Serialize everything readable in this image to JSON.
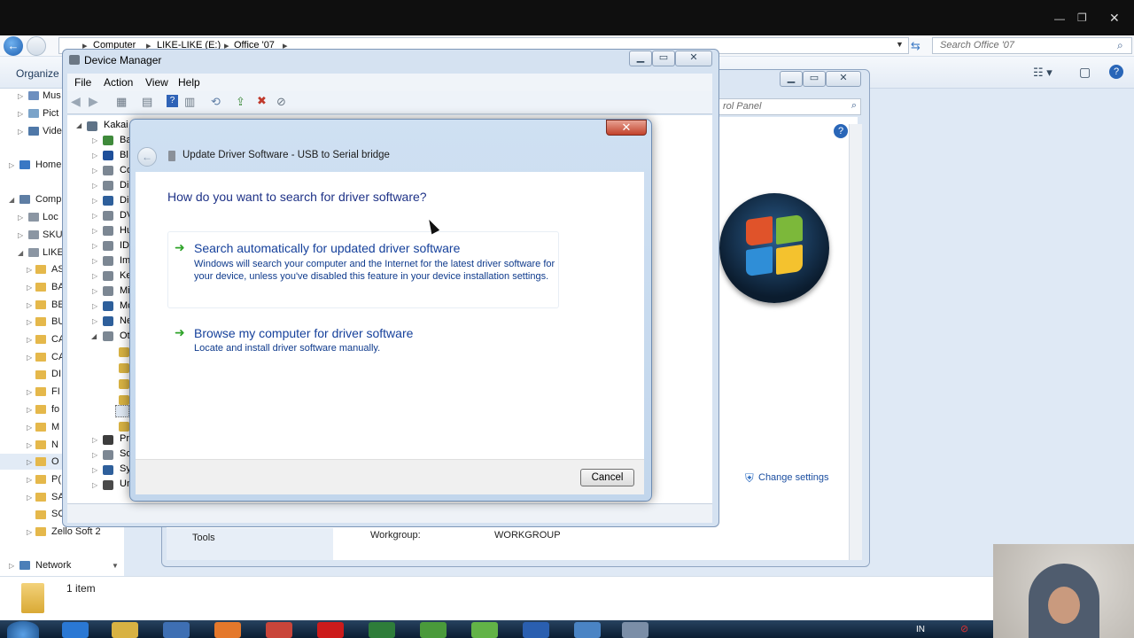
{
  "explorer": {
    "breadcrumb": [
      "Computer",
      "LIKE-LIKE (E:)",
      "Office '07"
    ],
    "search_placeholder": "Search Office '07",
    "organize_label": "Organize",
    "nav": {
      "items_top": [
        "Mus",
        "Pict",
        "Vide"
      ],
      "home_label": "Home",
      "computer_label": "Comp",
      "drives": [
        "Loc",
        "SKU",
        "LIKE"
      ],
      "folders": [
        "AS",
        "BA",
        "BE",
        "BU",
        "CA",
        "CA",
        "DI",
        "FI",
        "fo",
        "M",
        "N",
        "O",
        "P(",
        "SA",
        "SC"
      ],
      "zello_label": "Zello Soft 2",
      "network_label": "Network"
    },
    "details_text": "1 item"
  },
  "control_panel": {
    "search_placeholder": "rol Panel",
    "change_settings": "Change settings",
    "tools_label": "Tools",
    "workgroup_label": "Workgroup:",
    "workgroup_value": "WORKGROUP"
  },
  "device_manager": {
    "title": "Device Manager",
    "menu": [
      "File",
      "Action",
      "View",
      "Help"
    ],
    "tree_root": "Kakai",
    "tree_items": [
      "Ba",
      "Bl",
      "Co",
      "Di",
      "Di",
      "DV",
      "Hu",
      "ID",
      "Im",
      "Ke",
      "Mi",
      "Mo",
      "Ne",
      "Ot",
      "Pr",
      "So",
      "Sy",
      "Un"
    ]
  },
  "update_driver": {
    "window_title": "Update Driver Software - USB to Serial bridge",
    "question": "How do you want to search for driver software?",
    "options": [
      {
        "title": "Search automatically for updated driver software",
        "description": "Windows will search your computer and the Internet for the latest driver software for your device, unless you've disabled this feature in your device installation settings."
      },
      {
        "title": "Browse my computer for driver software",
        "description": "Locate and install driver software manually."
      }
    ],
    "cancel_label": "Cancel"
  },
  "taskbar": {
    "language": "IN"
  },
  "colors": {
    "link_blue": "#15409b",
    "question_blue": "#1e3287",
    "arrow_green": "#2ea329",
    "close_red": "#c2422b"
  }
}
